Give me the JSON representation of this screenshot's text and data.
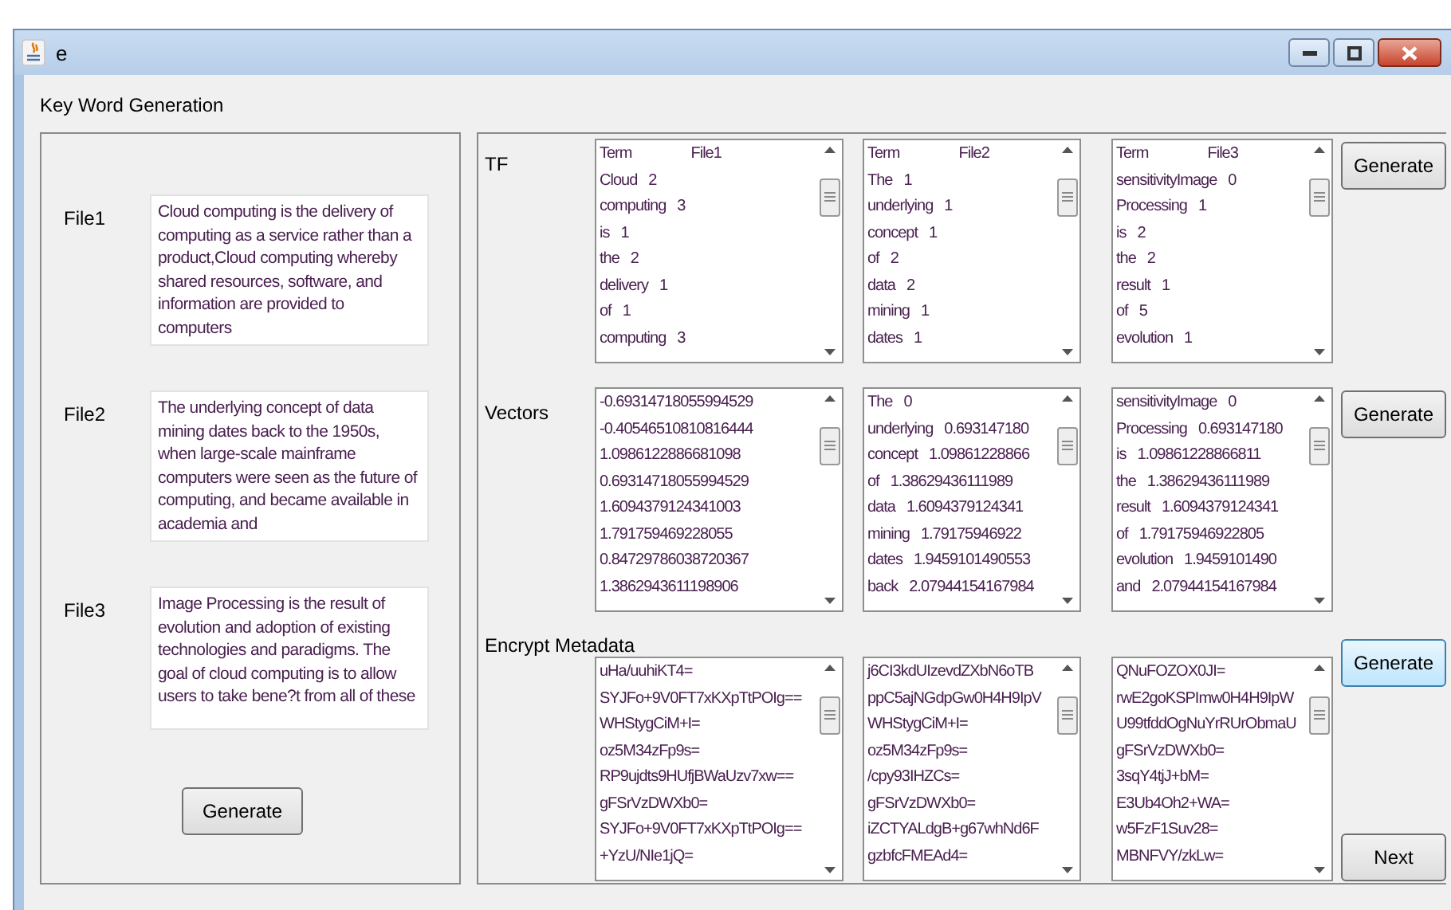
{
  "window": {
    "title": "e"
  },
  "heading": "Key Word Generation",
  "files": [
    {
      "label": "File1",
      "text": "Cloud computing is the delivery of computing as a service rather than a product,Cloud computing whereby shared resources, software, and information are provided to computers"
    },
    {
      "label": "File2",
      "text": "The underlying concept of data mining dates back to the 1950s, when large-scale mainframe computers were seen as the future of computing, and became available in academia and"
    },
    {
      "label": "File3",
      "text": "Image Processing is the result of evolution and adoption of existing technologies and paradigms. The goal of cloud computing is to allow users to take bene?t from all of these"
    }
  ],
  "left_button": "Generate",
  "sections": [
    {
      "label": "TF",
      "button": "Generate",
      "focused": false,
      "boxes": [
        [
          [
            "Term",
            "File1"
          ],
          [
            "Cloud",
            "2"
          ],
          [
            "computing",
            "3"
          ],
          [
            "is",
            "1"
          ],
          [
            "the",
            "2"
          ],
          [
            "delivery",
            "1"
          ],
          [
            "of",
            "1"
          ],
          [
            "computing",
            "3"
          ]
        ],
        [
          [
            "Term",
            "File2"
          ],
          [
            "The",
            "1"
          ],
          [
            "underlying",
            "1"
          ],
          [
            "concept",
            "1"
          ],
          [
            "of",
            "2"
          ],
          [
            "data",
            "2"
          ],
          [
            "mining",
            "1"
          ],
          [
            "dates",
            "1"
          ]
        ],
        [
          [
            "Term",
            "File3"
          ],
          [
            "sensitivityImage",
            "0"
          ],
          [
            "Processing",
            "1"
          ],
          [
            "is",
            "2"
          ],
          [
            "the",
            "2"
          ],
          [
            "result",
            "1"
          ],
          [
            "of",
            "5"
          ],
          [
            "evolution",
            "1"
          ]
        ]
      ]
    },
    {
      "label": "Vectors",
      "button": "Generate",
      "focused": false,
      "boxes": [
        [
          [
            "-0.69314718055994529"
          ],
          [
            "-0.40546510810816444"
          ],
          [
            "1.0986122886681098"
          ],
          [
            "0.69314718055994529"
          ],
          [
            "1.6094379124341003"
          ],
          [
            "1.791759469228055"
          ],
          [
            "0.84729786038720367"
          ],
          [
            "1.3862943611198906"
          ]
        ],
        [
          [
            "The",
            "0"
          ],
          [
            "underlying",
            "0.693147180"
          ],
          [
            "concept",
            "1.09861228866"
          ],
          [
            "of",
            "1.38629436111989"
          ],
          [
            "data",
            "1.6094379124341"
          ],
          [
            "mining",
            "1.79175946922"
          ],
          [
            "dates",
            "1.9459101490553"
          ],
          [
            "back",
            "2.07944154167984"
          ]
        ],
        [
          [
            "sensitivityImage",
            "0"
          ],
          [
            "Processing",
            "0.693147180"
          ],
          [
            "is",
            "1.09861228866811"
          ],
          [
            "the",
            "1.38629436111989"
          ],
          [
            "result",
            "1.6094379124341"
          ],
          [
            "of",
            "1.79175946922805"
          ],
          [
            "evolution",
            "1.9459101490"
          ],
          [
            "and",
            "2.07944154167984"
          ]
        ]
      ]
    },
    {
      "label": "Encrypt Metadata",
      "button": "Generate",
      "focused": true,
      "boxes": [
        [
          [
            "uHa/uuhiKT4="
          ],
          [
            "SYJFo+9V0FT7xKXpTtPOIg=="
          ],
          [
            "WHStygCiM+I="
          ],
          [
            "oz5M34zFp9s="
          ],
          [
            "RP9ujdts9HUfjBWaUzv7xw=="
          ],
          [
            "gFSrVzDWXb0="
          ],
          [
            "SYJFo+9V0FT7xKXpTtPOIg=="
          ],
          [
            "+YzU/NIe1jQ="
          ]
        ],
        [
          [
            "j6CI3kdUIzevdZXbN6oTB"
          ],
          [
            "ppC5ajNGdpGw0H4H9IpV"
          ],
          [
            "WHStygCiM+I="
          ],
          [
            "oz5M34zFp9s="
          ],
          [
            "/cpy93IHZCs="
          ],
          [
            "gFSrVzDWXb0="
          ],
          [
            "iZCTYALdgB+g67whNd6F"
          ],
          [
            "gzbfcFMEAd4="
          ]
        ],
        [
          [
            "QNuFOZOX0JI="
          ],
          [
            "rwE2goKSPImw0H4H9IpW"
          ],
          [
            "U99tfddOgNuYrRUrObmaU"
          ],
          [
            "gFSrVzDWXb0="
          ],
          [
            "3sqY4tjJ+bM="
          ],
          [
            "E3Ub4Oh2+WA="
          ],
          [
            "w5FzF1Suv28="
          ],
          [
            "MBNFVY/zkLw="
          ]
        ]
      ]
    }
  ],
  "next_button": "Next"
}
